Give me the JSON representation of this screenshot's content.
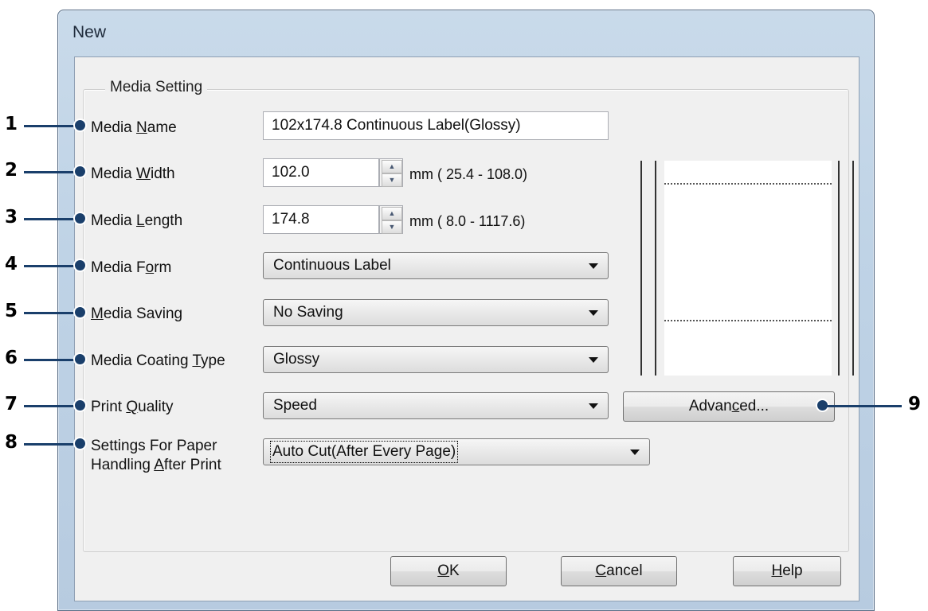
{
  "window": {
    "title": "New"
  },
  "group": {
    "label": "Media Setting"
  },
  "fields": {
    "media_name": {
      "label_pre": "Media ",
      "label_u": "N",
      "label_post": "ame",
      "value": "102x174.8 Continuous Label(Glossy)"
    },
    "media_width": {
      "label_pre": "Media ",
      "label_u": "W",
      "label_post": "idth",
      "value": "102.0",
      "range": "mm ( 25.4 - 108.0)"
    },
    "media_length": {
      "label_pre": "Media ",
      "label_u": "L",
      "label_post": "ength",
      "value": "174.8",
      "range": "mm (  8.0 - 1117.6)"
    },
    "media_form": {
      "label_pre": "Media F",
      "label_u": "o",
      "label_post": "rm",
      "value": "Continuous Label"
    },
    "media_saving": {
      "label_pre": "",
      "label_u": "M",
      "label_post": "edia Saving",
      "value": "No Saving"
    },
    "media_coating": {
      "label_pre": "Media Coating ",
      "label_u": "T",
      "label_post": "ype",
      "value": "Glossy"
    },
    "print_quality": {
      "label_pre": "Print ",
      "label_u": "Q",
      "label_post": "uality",
      "value": "Speed"
    },
    "paper_handling": {
      "label_line1": "Settings For Paper",
      "label_pre": "Handling ",
      "label_u": "A",
      "label_post": "fter Print",
      "value": "Auto Cut(After Every Page)"
    }
  },
  "buttons": {
    "advanced": {
      "pre": "Advan",
      "u": "c",
      "post": "ed..."
    },
    "ok": {
      "pre": "",
      "u": "O",
      "post": "K"
    },
    "cancel": {
      "pre": "",
      "u": "C",
      "post": "ancel"
    },
    "help": {
      "pre": "",
      "u": "H",
      "post": "elp"
    }
  },
  "callouts": [
    "1",
    "2",
    "3",
    "4",
    "5",
    "6",
    "7",
    "8",
    "9"
  ],
  "colors": {
    "callout_line": "#1a3f6b",
    "window_frame": "#c9daea",
    "client_bg": "#f0f0f0"
  }
}
